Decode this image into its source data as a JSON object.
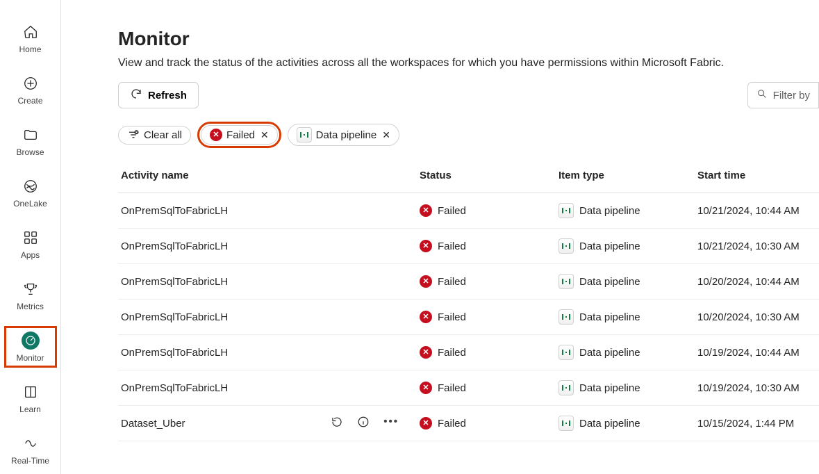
{
  "nav": {
    "items": [
      {
        "id": "home",
        "label": "Home"
      },
      {
        "id": "create",
        "label": "Create"
      },
      {
        "id": "browse",
        "label": "Browse"
      },
      {
        "id": "onelake",
        "label": "OneLake"
      },
      {
        "id": "apps",
        "label": "Apps"
      },
      {
        "id": "metrics",
        "label": "Metrics"
      },
      {
        "id": "monitor",
        "label": "Monitor"
      },
      {
        "id": "learn",
        "label": "Learn"
      },
      {
        "id": "realtime",
        "label": "Real-Time"
      }
    ]
  },
  "header": {
    "title": "Monitor",
    "subtitle": "View and track the status of the activities across all the workspaces for which you have permissions within Microsoft Fabric."
  },
  "toolbar": {
    "refresh": "Refresh",
    "filter_by": "Filter by"
  },
  "chips": {
    "clear_all": "Clear all",
    "failed": "Failed",
    "pipeline": "Data pipeline"
  },
  "table": {
    "headers": {
      "name": "Activity name",
      "status": "Status",
      "itemtype": "Item type",
      "start": "Start time"
    },
    "rows": [
      {
        "name": "OnPremSqlToFabricLH",
        "status": "Failed",
        "itemtype": "Data pipeline",
        "start": "10/21/2024, 10:44 AM"
      },
      {
        "name": "OnPremSqlToFabricLH",
        "status": "Failed",
        "itemtype": "Data pipeline",
        "start": "10/21/2024, 10:30 AM"
      },
      {
        "name": "OnPremSqlToFabricLH",
        "status": "Failed",
        "itemtype": "Data pipeline",
        "start": "10/20/2024, 10:44 AM"
      },
      {
        "name": "OnPremSqlToFabricLH",
        "status": "Failed",
        "itemtype": "Data pipeline",
        "start": "10/20/2024, 10:30 AM"
      },
      {
        "name": "OnPremSqlToFabricLH",
        "status": "Failed",
        "itemtype": "Data pipeline",
        "start": "10/19/2024, 10:44 AM"
      },
      {
        "name": "OnPremSqlToFabricLH",
        "status": "Failed",
        "itemtype": "Data pipeline",
        "start": "10/19/2024, 10:30 AM"
      },
      {
        "name": "Dataset_Uber",
        "status": "Failed",
        "itemtype": "Data pipeline",
        "start": "10/15/2024, 1:44 PM",
        "actions": true
      }
    ]
  }
}
